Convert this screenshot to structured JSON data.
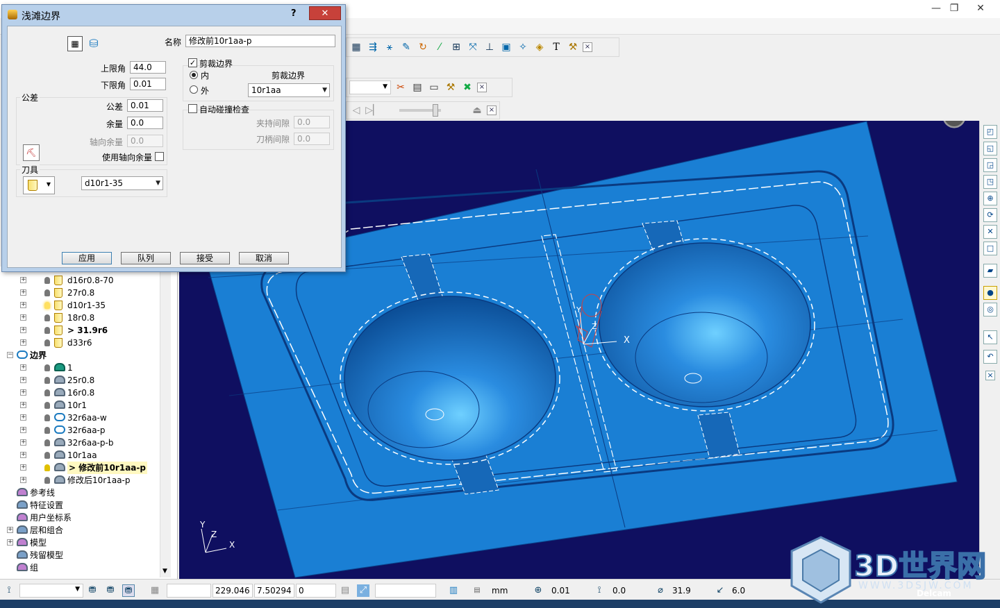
{
  "window": {
    "minimize": "—",
    "maximize": "❐",
    "close": "✕"
  },
  "dialog": {
    "title": "浅滩边界",
    "help": "?",
    "close": "✕",
    "name_label": "名称",
    "name_value": "修改前10r1aa-p",
    "upper_angle_label": "上限角",
    "upper_angle_value": "44.0",
    "lower_angle_label": "下限角",
    "lower_angle_value": "0.01",
    "tolerance_group": "公差",
    "tolerance_label": "公差",
    "tolerance_value": "0.01",
    "thickness_label": "余量",
    "thickness_value": "0.0",
    "axial_thickness_label": "轴向余量",
    "axial_thickness_value": "0.0",
    "use_axial_label": "使用轴向余量",
    "tool_group": "刀具",
    "tool_value": "d10r1-35",
    "trim_boundary_check_label": "剪裁边界",
    "trim_boundary_checked": true,
    "inside_label": "内",
    "outside_label": "外",
    "trim_boundary_title": "剪裁边界",
    "trim_boundary_value": "10r1aa",
    "auto_collision_label": "自动碰撞检查",
    "holder_clearance_label": "夹持间隙",
    "holder_clearance_value": "0.0",
    "shank_clearance_label": "刀柄间隙",
    "shank_clearance_value": "0.0",
    "buttons": {
      "apply": "应用",
      "queue": "队列",
      "accept": "接受",
      "cancel": "取消"
    }
  },
  "tree": {
    "items": [
      {
        "label": "d16r0.8-70",
        "type": "tool"
      },
      {
        "label": "27r0.8",
        "type": "tool"
      },
      {
        "label": "d10r1-35",
        "type": "tool-active"
      },
      {
        "label": "18r0.8",
        "type": "tool"
      },
      {
        "label": "> 31.9r6",
        "type": "tool-bold"
      },
      {
        "label": "d33r6",
        "type": "tool"
      },
      {
        "label": "边界",
        "type": "folder-boundary"
      },
      {
        "label": "1",
        "type": "boundary-green"
      },
      {
        "label": "25r0.8",
        "type": "boundary-hat"
      },
      {
        "label": "16r0.8",
        "type": "boundary-hat"
      },
      {
        "label": "10r1",
        "type": "boundary-hat"
      },
      {
        "label": "32r6aa-w",
        "type": "boundary"
      },
      {
        "label": "32r6aa-p",
        "type": "boundary"
      },
      {
        "label": "32r6aa-p-b",
        "type": "boundary-hat"
      },
      {
        "label": "10r1aa",
        "type": "boundary-hat"
      },
      {
        "label": "> 修改前10r1aa-p",
        "type": "boundary-active"
      },
      {
        "label": "修改后10r1aa-p",
        "type": "boundary-hat"
      },
      {
        "label": "参考线",
        "type": "root"
      },
      {
        "label": "特征设置",
        "type": "root"
      },
      {
        "label": "用户坐标系",
        "type": "root"
      },
      {
        "label": "层和组合",
        "type": "root-exp"
      },
      {
        "label": "模型",
        "type": "root-exp"
      },
      {
        "label": "残留模型",
        "type": "root"
      },
      {
        "label": "组",
        "type": "root"
      }
    ]
  },
  "viewport": {
    "axis_x": "X",
    "axis_y": "Y",
    "axis_z": "Z",
    "colors": {
      "background": "#0f0f60",
      "model": "#1a7fd4"
    }
  },
  "statusbar": {
    "x": "229.046",
    "y": "7.50294",
    "z": "0",
    "units": "mm",
    "tolerance": "0.01",
    "thickness": "0.0",
    "diameter": "31.9",
    "stepover": "6.0"
  },
  "watermark": {
    "brand": "3D世界网",
    "url": "WWW.3DSJW.COM",
    "corner": "Delcam"
  }
}
